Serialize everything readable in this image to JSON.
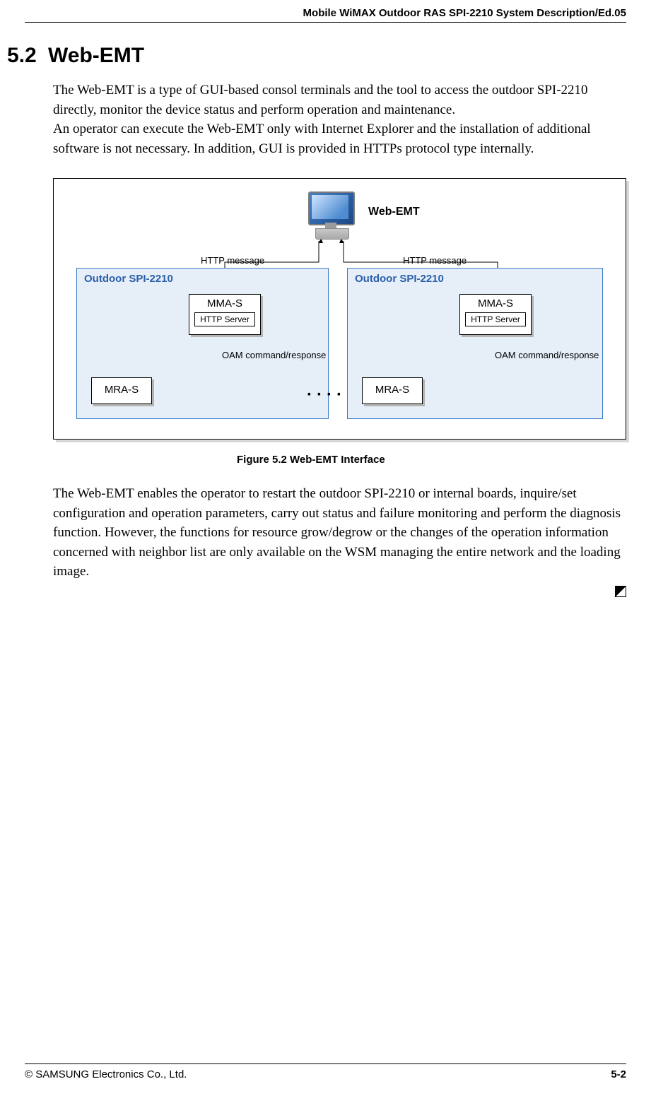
{
  "header": {
    "doc_title": "Mobile WiMAX Outdoor RAS SPI-2210 System Description/Ed.05"
  },
  "section": {
    "number": "5.2",
    "title": "Web-EMT",
    "para1": "The Web-EMT is a type of GUI-based consol terminals and the tool to access the outdoor SPI-2210 directly, monitor the device status and perform operation and maintenance.",
    "para2": "An operator can execute the Web-EMT only with Internet Explorer and the installation of additional software is not necessary. In addition, GUI is provided in HTTPs protocol type internally.",
    "para3": "The Web-EMT enables the operator to restart the outdoor SPI-2210 or internal boards, inquire/set configuration and operation parameters, carry out status and failure monitoring and perform the diagnosis function. However, the functions for resource grow/degrow or the changes of the operation information concerned with neighbor list are only available on the WSM managing the entire network and the loading image."
  },
  "diagram": {
    "web_emt_label": "Web-EMT",
    "http_msg_left": "HTTP message",
    "http_msg_right": "HTTP message",
    "spi_title_left": "Outdoor SPI-2210",
    "spi_title_right": "Outdoor SPI-2210",
    "mma_s": "MMA-S",
    "http_server": "HTTP Server",
    "mra_s": "MRA-S",
    "oam_left": "OAM command/response",
    "oam_right": "OAM command/response",
    "ellipsis": "····",
    "caption": "Figure 5.2    Web-EMT Interface"
  },
  "footer": {
    "copyright": "© SAMSUNG Electronics Co., Ltd.",
    "page": "5-2"
  }
}
